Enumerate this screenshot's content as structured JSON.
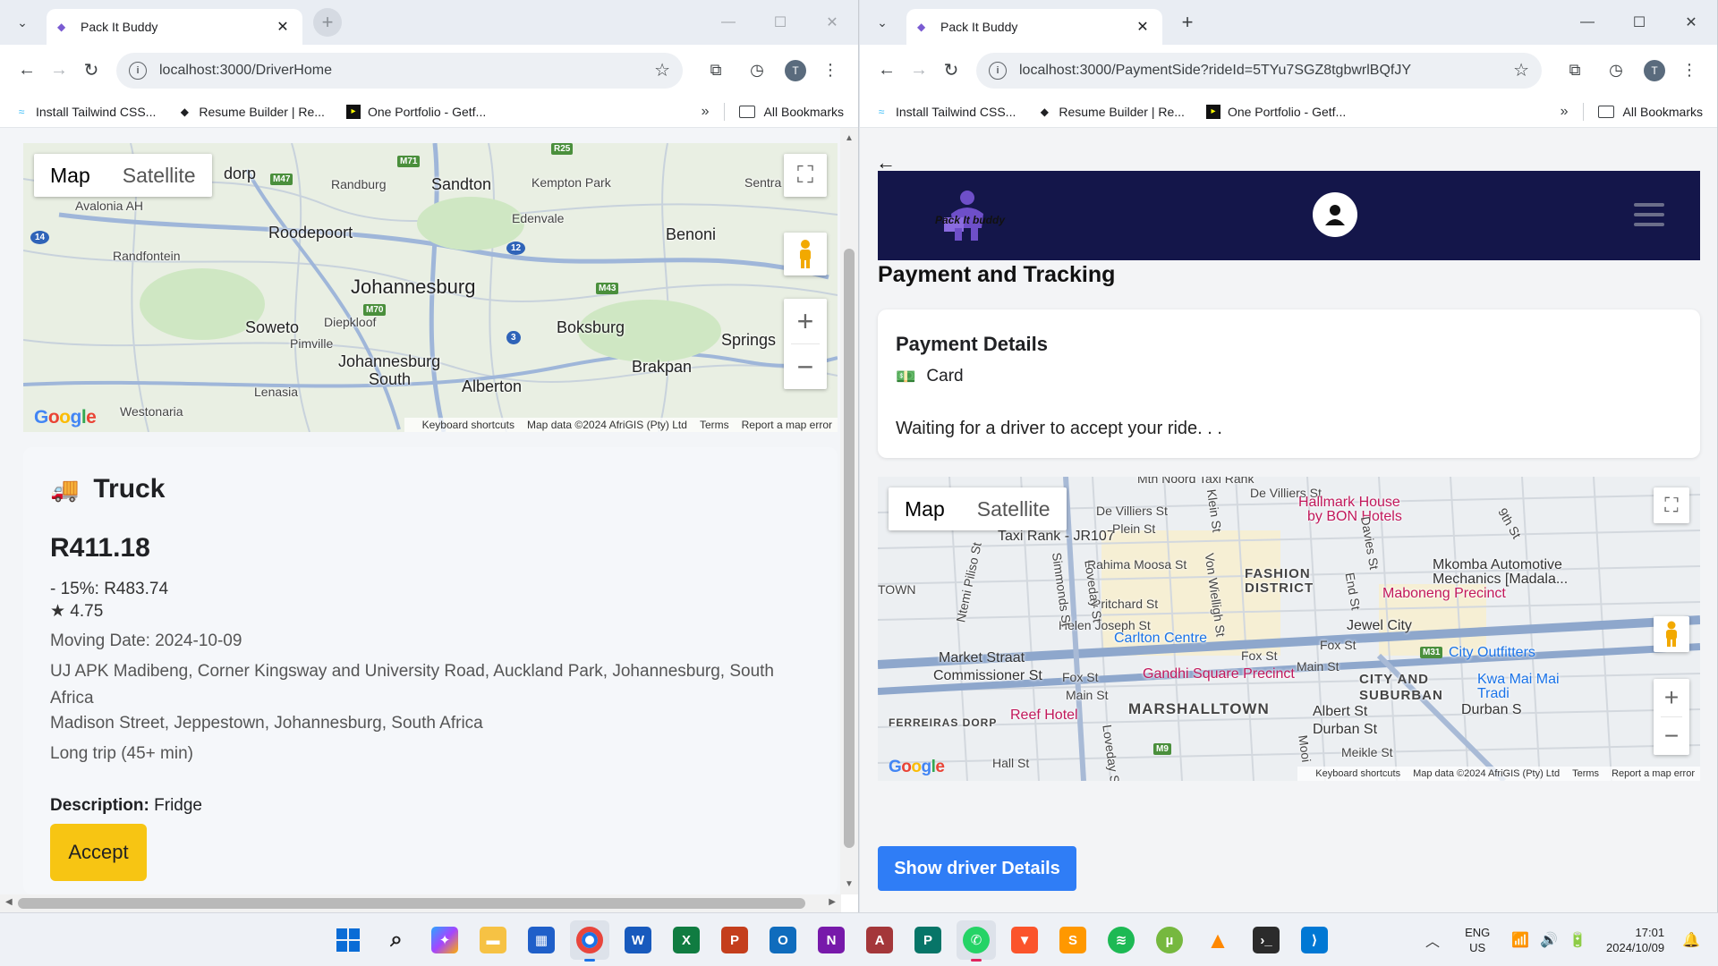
{
  "left_window": {
    "tab_title": "Pack It Buddy",
    "url": "localhost:3000/DriverHome",
    "avatar_letter": "T",
    "bookmarks": [
      "Install Tailwind CSS...",
      "Resume Builder | Re...",
      "One Portfolio - Getf...",
      "All Bookmarks"
    ],
    "map": {
      "map_label": "Map",
      "satellite_label": "Satellite",
      "places": {
        "johannesburg": "Johannesburg",
        "sandton": "Sandton",
        "roodepoort": "Roodepoort",
        "randburg": "Randburg",
        "kempton_park": "Kempton Park",
        "edenvale": "Edenvale",
        "benoni": "Benoni",
        "soweto": "Soweto",
        "diepkloof": "Diepkloof",
        "pimville": "Pimville",
        "johannesburg_south_1": "Johannesburg",
        "johannesburg_south_2": "South",
        "boksburg": "Boksburg",
        "brakpan": "Brakpan",
        "springs": "Springs",
        "alberton": "Alberton",
        "lenasia": "Lenasia",
        "westonaria": "Westonaria",
        "randfontein": "Randfontein",
        "avalonia": "Avalonia AH",
        "sentra": "Sentra",
        "dorp": "dorp"
      },
      "footer": {
        "keyboard": "Keyboard shortcuts",
        "mapdata": "Map data ©2024 AfriGIS (Pty) Ltd",
        "terms": "Terms",
        "report": "Report a map error"
      }
    },
    "job": {
      "vehicle": "Truck",
      "price": "R411.18",
      "discount": "- 15%: R483.74",
      "rating": "★ 4.75",
      "moving_date": "Moving Date: 2024-10-09",
      "pickup": "UJ APK Madibeng, Corner Kingsway and University Road, Auckland Park, Johannesburg, South Africa",
      "dropoff": "Madison Street, Jeppestown, Johannesburg, South Africa",
      "trip_length": "Long trip (45+ min)",
      "description_label": "Description:",
      "description_value": "Fridge",
      "accept_label": "Accept"
    }
  },
  "right_window": {
    "tab_title": "Pack It Buddy",
    "url": "localhost:3000/PaymentSide?rideId=5TYu7SGZ8tgbwrlBQfJY",
    "avatar_letter": "T",
    "bookmarks": [
      "Install Tailwind CSS...",
      "Resume Builder | Re...",
      "One Portfolio - Getf...",
      "All Bookmarks"
    ],
    "logo_text": "Pack It buddy",
    "page_heading": "Payment and Tracking",
    "payment": {
      "title": "Payment Details",
      "method": "Card",
      "status": "Waiting for a driver to accept your ride. . ."
    },
    "map": {
      "map_label": "Map",
      "satellite_label": "Satellite",
      "places": {
        "taxi_rank": "Taxi Rank - JR107",
        "de_villiers_1": "De Villiers St",
        "de_villiers_2": "De Villiers St",
        "plein": "Plein St",
        "rahima": "Rahima Moosa St",
        "fashion_1": "FASHION",
        "fashion_2": "DISTRICT",
        "pritchard": "Pritchard St",
        "helen": "Helen Joseph St",
        "carlton": "Carlton Centre",
        "market": "Market Straat",
        "commissioner": "Commissioner St",
        "fox_1": "Fox St",
        "fox_2": "Fox St",
        "fox_3": "Fox St",
        "main_1": "Main St",
        "main_2": "Main St",
        "gandhi": "Gandhi Square Precinct",
        "marshalltown": "MARSHALLTOWN",
        "reef": "Reef Hotel",
        "ferreiras": "FERREIRAS DORP",
        "hall": "Hall St",
        "city_suburban_1": "CITY AND",
        "city_suburban_2": "SUBURBAN",
        "albert": "Albert St",
        "durban_1": "Durban St",
        "durban_2": "Durban S",
        "meikle": "Meikle St",
        "jewel": "Jewel City",
        "maboneng": "Maboneng Precinct",
        "hallmark_1": "Hallmark House",
        "hallmark_2": "by BON Hotels",
        "mkomba_1": "Mkomba Automotive",
        "mkomba_2": "Mechanics [Madala...",
        "city_outfitters": "City Outfitters",
        "kwa_mai_1": "Kwa Mai Mai",
        "kwa_mai_2": "Tradi",
        "end": "End St",
        "davies": "Davies St",
        "simmonds": "Simmonds St",
        "loveday_1": "Loveday St",
        "loveday_2": "Loveday St",
        "von_wielligh": "Von Wielligh St",
        "klein": "Klein St",
        "ntemi": "Ntemi Piliso St",
        "town": "TOWN",
        "mooi": "Mooi",
        "ninth": "9th St",
        "taxi_noord": "Mtn Noord Taxi Rank"
      },
      "footer": {
        "keyboard": "Keyboard shortcuts",
        "mapdata": "Map data ©2024 AfriGIS (Pty) Ltd",
        "terms": "Terms",
        "report": "Report a map error"
      }
    },
    "driver_button": "Show driver Details"
  },
  "taskbar": {
    "lang_1": "ENG",
    "lang_2": "US",
    "time": "17:01",
    "date": "2024/10/09"
  }
}
